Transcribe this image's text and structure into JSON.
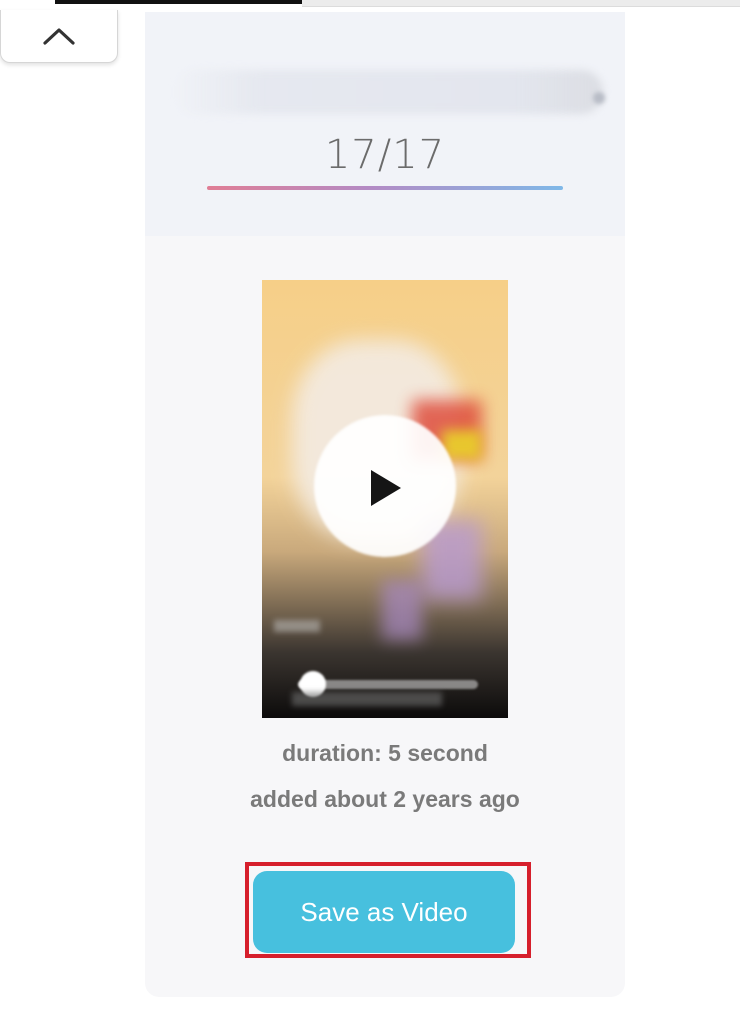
{
  "header": {
    "counter": "17/17"
  },
  "video": {
    "duration": "duration: 5 second",
    "added": "added about 2 years ago",
    "progress_fraction": 0.06
  },
  "actions": {
    "save_label": "Save as Video"
  },
  "colors": {
    "save_button": "#47c0de",
    "highlight": "#d61f2c",
    "underline_start": "#e07d95",
    "underline_end": "#7fb8e8"
  },
  "icons": {
    "collapse": "chevron-up-icon",
    "play": "play-icon"
  }
}
